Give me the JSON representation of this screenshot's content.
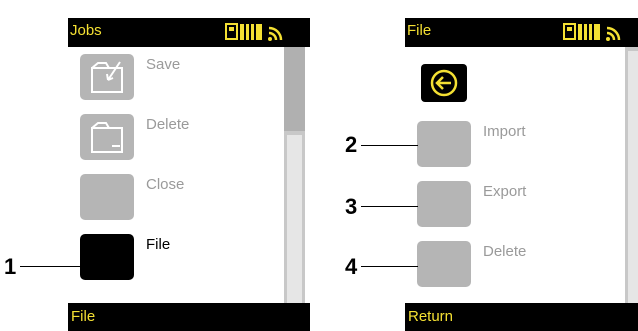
{
  "left_screen": {
    "title": "Jobs",
    "items": [
      {
        "label": "Save",
        "icon": "save-icon",
        "selected": false
      },
      {
        "label": "Delete",
        "icon": "delete-folder-icon",
        "selected": false
      },
      {
        "label": "Close",
        "icon": "",
        "selected": false
      },
      {
        "label": "File",
        "icon": "",
        "selected": true
      }
    ],
    "softkey_label": "File"
  },
  "right_screen": {
    "title": "File",
    "back_icon": "back-arrow-icon",
    "items": [
      {
        "label": "Import",
        "icon": "",
        "selected": false
      },
      {
        "label": "Export",
        "icon": "",
        "selected": false
      },
      {
        "label": "Delete",
        "icon": "",
        "selected": false
      }
    ],
    "softkey_label": "Return"
  },
  "callouts": [
    "1",
    "2",
    "3",
    "4"
  ],
  "status_icons": [
    "memory-card-icon",
    "battery-icon",
    "signal-icon"
  ],
  "colors": {
    "accent": "#f4e033",
    "bar": "#000000",
    "tile": "#b5b5b5",
    "text_inactive": "#9a9a9a"
  }
}
